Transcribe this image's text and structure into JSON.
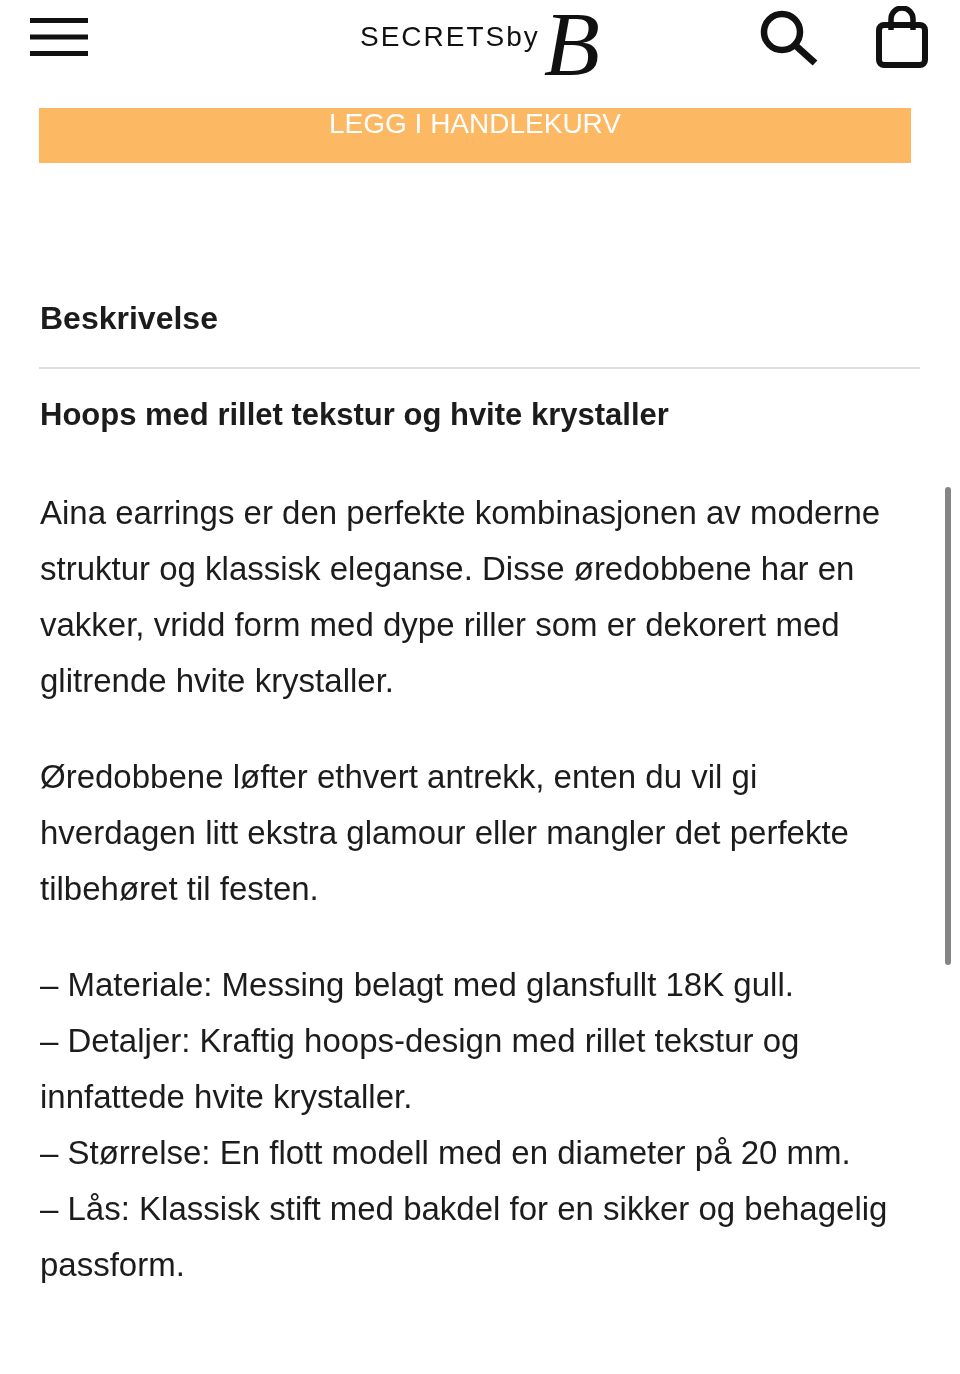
{
  "header": {
    "logo": {
      "wordmark": "SECRETSby",
      "initial": "B"
    }
  },
  "add_to_cart_button": {
    "label": "LEGG I HANDLEKURV"
  },
  "description": {
    "title": "Beskrivelse",
    "heading": "Hoops med rillet tekstur og hvite krystaller",
    "paragraphs": [
      "Aina earrings er den perfekte kombinasjonen av moderne struktur og klassisk eleganse. Disse øredobbene har en vakker, vridd form med dype riller som er dekorert med glitrende hvite krystaller.",
      "Øredobbene løfter ethvert antrekk, enten du vil gi hverdagen litt ekstra glamour eller mangler det perfekte tilbehøret til festen."
    ],
    "details": [
      "– Materiale: Messing belagt med glansfullt 18K gull.",
      "– Detaljer: Kraftig hoops-design med rillet tekstur og innfattede hvite krystaller.",
      "– Størrelse: En flott modell med en diameter på 20 mm.",
      "– Lås: Klassisk stift med bakdel for en sikker og behagelig passform."
    ]
  }
}
